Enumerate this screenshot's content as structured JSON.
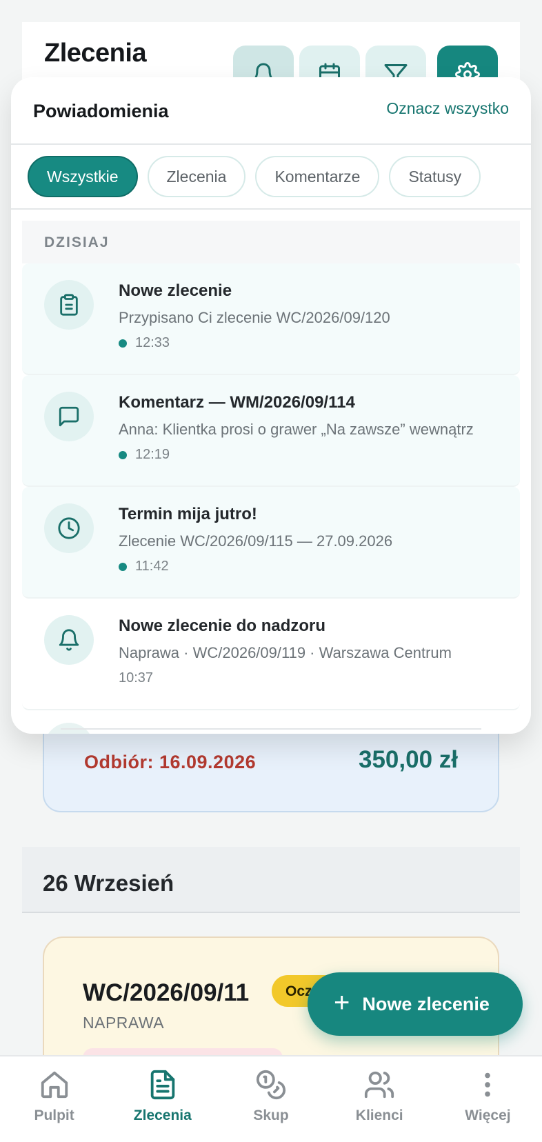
{
  "page": {
    "title": "Zlecenia"
  },
  "notifications": {
    "title": "Powiadomienia",
    "mark_all": "Oznacz wszystko",
    "filters": [
      {
        "label": "Wszystkie",
        "active": true
      },
      {
        "label": "Zlecenia",
        "active": false
      },
      {
        "label": "Komentarze",
        "active": false
      },
      {
        "label": "Statusy",
        "active": false
      }
    ],
    "day_header": "DZISIAJ",
    "items": [
      {
        "icon": "clipboard-icon",
        "title": "Nowe zlecenie",
        "desc": "Przypisano Ci zlecenie WC/2026/09/120",
        "time": "12:33",
        "unread": true
      },
      {
        "icon": "comment-icon",
        "title": "Komentarz — WM/2026/09/114",
        "desc": "Anna: Klientka prosi o grawer „Na zawsze” wewnątrz",
        "time": "12:19",
        "unread": true
      },
      {
        "icon": "clock-icon",
        "title": "Termin mija jutro!",
        "desc": "Zlecenie WC/2026/09/115 — 27.09.2026",
        "time": "11:42",
        "unread": true
      },
      {
        "icon": "bell-icon",
        "title": "Nowe zlecenie do nadzoru",
        "desc": "Naprawa · WC/2026/09/119 · Warszawa Centrum",
        "time": "10:37",
        "unread": false
      }
    ]
  },
  "previous_card": {
    "pickup": "Odbiór: 16.09.2026",
    "amount": "350,00 zł"
  },
  "date_section": "26 Wrzesień",
  "order_card": {
    "code": "WC/2026/09/11",
    "type": "NAPRAWA",
    "status": "Oczekuje"
  },
  "fab": {
    "label": "Nowe zlecenie"
  },
  "nav": [
    {
      "label": "Pulpit",
      "icon": "home-icon",
      "active": false
    },
    {
      "label": "Zlecenia",
      "icon": "document-icon",
      "active": true
    },
    {
      "label": "Skup",
      "icon": "coins-icon",
      "active": false
    },
    {
      "label": "Klienci",
      "icon": "users-icon",
      "active": false
    },
    {
      "label": "Więcej",
      "icon": "more-vertical-icon",
      "active": false
    }
  ],
  "colors": {
    "primary": "#178a82",
    "pickup_red": "#b33a30",
    "status_yellow": "#f2c82a"
  }
}
